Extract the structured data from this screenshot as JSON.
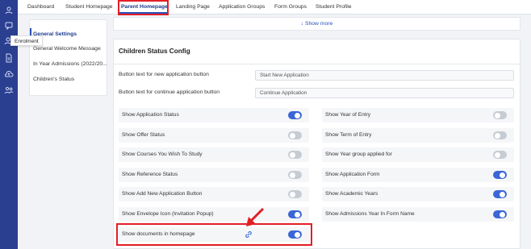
{
  "tooltip": {
    "text": "Enrolment"
  },
  "rail": {
    "icons": [
      "users-icon",
      "chat-icon",
      "user-switch-icon",
      "document-icon",
      "cloud-upload-icon",
      "group-icon"
    ]
  },
  "tabs": [
    {
      "label": "Dashboard"
    },
    {
      "label": "Student Homepage"
    },
    {
      "label": "Parent Homepage",
      "active": true
    },
    {
      "label": "Landing Page"
    },
    {
      "label": "Application Groups"
    },
    {
      "label": "Form Groups"
    },
    {
      "label": "Student Profile"
    }
  ],
  "left_panel": {
    "items": [
      {
        "label": "General Settings",
        "active": true
      },
      {
        "label": "General Welcome Message"
      },
      {
        "label": "In Year Admissions (2022/20..."
      },
      {
        "label": "Children's Status"
      }
    ]
  },
  "show_more": {
    "label": "Show more",
    "icon": "arrow-down-icon"
  },
  "card": {
    "title": "Children Status Config",
    "fields": [
      {
        "label": "Button text for new application button",
        "value": "Start New Application"
      },
      {
        "label": "Button text for continue application button",
        "value": "Continue Application"
      }
    ],
    "toggles_left": [
      {
        "label": "Show Application Status",
        "on": true
      },
      {
        "label": "Show Offer Status",
        "on": false
      },
      {
        "label": "Show Courses You Wish To Study",
        "on": false
      },
      {
        "label": "Show Reference Status",
        "on": false
      },
      {
        "label": "Show Add New Application Button",
        "on": false
      },
      {
        "label": "Show Envelope Icon (Invitation Popup)",
        "on": true
      },
      {
        "label": "Show documents in homepage",
        "on": true,
        "icon": "link-icon"
      }
    ],
    "toggles_right": [
      {
        "label": "Show Year of Entry",
        "on": false
      },
      {
        "label": "Show Term of Entry",
        "on": false
      },
      {
        "label": "Show Year group applied for",
        "on": false
      },
      {
        "label": "Show Application Form",
        "on": true
      },
      {
        "label": "Show Academic Years",
        "on": true
      },
      {
        "label": "Show Admissions Year In Form Name",
        "on": true
      }
    ]
  },
  "colors": {
    "accent": "#2a4fb8",
    "rail": "#2a3f8f",
    "toggle_on": "#3a66d6",
    "toggle_off": "#c6ccd4",
    "annotation": "#e21e26"
  }
}
